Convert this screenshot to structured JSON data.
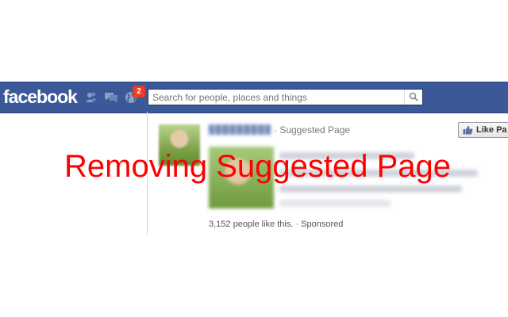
{
  "header": {
    "logo_text": "facebook",
    "notification_count": "2",
    "icons": [
      "friend-requests-icon",
      "messages-icon",
      "notifications-globe-icon"
    ],
    "brand_color": "#3b5998"
  },
  "search": {
    "placeholder": "Search for people, places and things",
    "icon": "search-icon"
  },
  "ad": {
    "type_label": "· Suggested Page",
    "like_label": "Like Pa",
    "footer": "3,152 people like this. · Sponsored"
  },
  "overlay": {
    "title": "Removing Suggested Page",
    "color": "#ff0000"
  }
}
